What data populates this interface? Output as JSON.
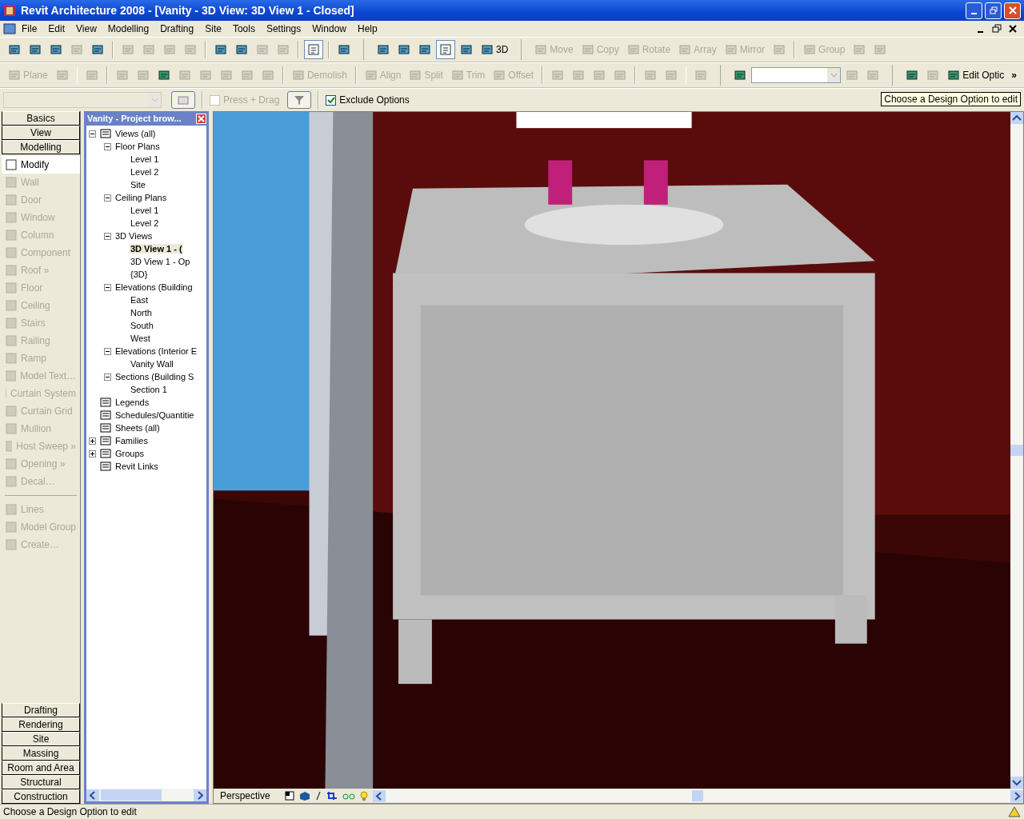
{
  "window": {
    "title": "Revit Architecture 2008 - [Vanity - 3D View: 3D View 1 - Closed]"
  },
  "menu": [
    "File",
    "Edit",
    "View",
    "Modelling",
    "Drafting",
    "Site",
    "Tools",
    "Settings",
    "Window",
    "Help"
  ],
  "toolbar_1": [
    {
      "kind": "tool",
      "disabled": false
    },
    {
      "kind": "tool",
      "disabled": false
    },
    {
      "kind": "tool",
      "disabled": false
    },
    {
      "kind": "tool",
      "disabled": true
    },
    {
      "kind": "tool",
      "disabled": false
    },
    {
      "kind": "separator"
    },
    {
      "kind": "tool",
      "disabled": true
    },
    {
      "kind": "tool",
      "disabled": true
    },
    {
      "kind": "tool",
      "disabled": true
    },
    {
      "kind": "tool",
      "disabled": true
    },
    {
      "kind": "separator"
    },
    {
      "kind": "tool",
      "disabled": false
    },
    {
      "kind": "tool",
      "disabled": false
    },
    {
      "kind": "tool",
      "disabled": true
    },
    {
      "kind": "tool",
      "disabled": true
    },
    {
      "kind": "separator"
    },
    {
      "kind": "toggle",
      "on": true
    },
    {
      "kind": "separator"
    },
    {
      "kind": "tool",
      "disabled": false
    },
    {
      "kind": "gap"
    },
    {
      "kind": "tool",
      "disabled": false
    },
    {
      "kind": "tool",
      "disabled": false
    },
    {
      "kind": "tool",
      "disabled": false
    },
    {
      "kind": "toggle",
      "on": true
    },
    {
      "kind": "tool",
      "disabled": false
    },
    {
      "kind": "tool",
      "label": "3D",
      "disabled": false
    },
    {
      "kind": "gap"
    },
    {
      "kind": "tool",
      "label": "Move",
      "disabled": true
    },
    {
      "kind": "tool",
      "label": "Copy",
      "disabled": true
    },
    {
      "kind": "tool",
      "label": "Rotate",
      "disabled": true
    },
    {
      "kind": "tool",
      "label": "Array",
      "disabled": true
    },
    {
      "kind": "tool",
      "label": "Mirror",
      "disabled": true
    },
    {
      "kind": "tool",
      "disabled": true
    },
    {
      "kind": "separator"
    },
    {
      "kind": "tool",
      "label": "Group",
      "disabled": true
    },
    {
      "kind": "tool",
      "disabled": true
    },
    {
      "kind": "tool",
      "disabled": true
    }
  ],
  "toolbar_2": [
    {
      "kind": "tool",
      "label": "Plane",
      "disabled": true
    },
    {
      "kind": "tool",
      "disabled": true
    },
    {
      "kind": "separator"
    },
    {
      "kind": "tool",
      "disabled": true
    },
    {
      "kind": "separator"
    },
    {
      "kind": "tool",
      "disabled": true
    },
    {
      "kind": "tool",
      "disabled": true
    },
    {
      "kind": "tool",
      "disabled": false
    },
    {
      "kind": "tool",
      "disabled": true
    },
    {
      "kind": "tool",
      "disabled": true
    },
    {
      "kind": "tool",
      "disabled": true
    },
    {
      "kind": "tool",
      "disabled": true
    },
    {
      "kind": "tool",
      "disabled": true
    },
    {
      "kind": "separator"
    },
    {
      "kind": "tool",
      "label": "Demolish",
      "disabled": true
    },
    {
      "kind": "separator"
    },
    {
      "kind": "tool",
      "label": "Align",
      "disabled": true
    },
    {
      "kind": "tool",
      "label": "Split",
      "disabled": true
    },
    {
      "kind": "tool",
      "label": "Trim",
      "disabled": true
    },
    {
      "kind": "tool",
      "label": "Offset",
      "disabled": true
    },
    {
      "kind": "separator"
    },
    {
      "kind": "tool",
      "disabled": true
    },
    {
      "kind": "tool",
      "disabled": true
    },
    {
      "kind": "tool",
      "disabled": true
    },
    {
      "kind": "tool",
      "disabled": true
    },
    {
      "kind": "separator"
    },
    {
      "kind": "tool",
      "disabled": true
    },
    {
      "kind": "tool",
      "disabled": true
    },
    {
      "kind": "separator"
    },
    {
      "kind": "tool",
      "disabled": true
    },
    {
      "kind": "gap"
    },
    {
      "kind": "tool",
      "disabled": false
    },
    {
      "kind": "dropdown"
    },
    {
      "kind": "tool",
      "disabled": true
    },
    {
      "kind": "tool",
      "disabled": true
    },
    {
      "kind": "gap"
    },
    {
      "kind": "tool",
      "disabled": false
    },
    {
      "kind": "tool",
      "disabled": true
    },
    {
      "kind": "tool",
      "label": "Edit Optic",
      "disabled": false
    },
    {
      "kind": "more",
      "label": "»"
    }
  ],
  "options_bar": {
    "press_drag": {
      "label": "Press + Drag",
      "checked": false,
      "disabled": true
    },
    "exclude_options": {
      "label": "Exclude Options",
      "checked": true,
      "disabled": false
    }
  },
  "tooltip": "Choose a Design Option to edit",
  "design_bar": {
    "tabs_top": [
      "Basics",
      "View",
      "Modelling"
    ],
    "tools": [
      {
        "label": "Modify",
        "disabled": false,
        "selected": true
      },
      {
        "label": "Wall",
        "disabled": true,
        "selected": false
      },
      {
        "label": "Door",
        "disabled": true,
        "selected": false
      },
      {
        "label": "Window",
        "disabled": true,
        "selected": false
      },
      {
        "label": "Column",
        "disabled": true,
        "selected": false
      },
      {
        "label": "Component",
        "disabled": true,
        "selected": false
      },
      {
        "label": "Roof »",
        "disabled": true,
        "selected": false
      },
      {
        "label": "Floor",
        "disabled": true,
        "selected": false
      },
      {
        "label": "Ceiling",
        "disabled": true,
        "selected": false
      },
      {
        "label": "Stairs",
        "disabled": true,
        "selected": false
      },
      {
        "label": "Railing",
        "disabled": true,
        "selected": false
      },
      {
        "label": "Ramp",
        "disabled": true,
        "selected": false
      },
      {
        "label": "Model Text…",
        "disabled": true,
        "selected": false
      },
      {
        "label": "Curtain System",
        "disabled": true,
        "selected": false
      },
      {
        "label": "Curtain Grid",
        "disabled": true,
        "selected": false
      },
      {
        "label": "Mullion",
        "disabled": true,
        "selected": false
      },
      {
        "label": "Host Sweep »",
        "disabled": true,
        "selected": false
      },
      {
        "label": "Opening »",
        "disabled": true,
        "selected": false
      },
      {
        "label": "Decal…",
        "disabled": true,
        "selected": false
      }
    ],
    "tools_2": [
      {
        "label": "Lines",
        "disabled": true,
        "selected": false
      },
      {
        "label": "Model Group",
        "disabled": true,
        "selected": false
      },
      {
        "label": "Create…",
        "disabled": true,
        "selected": false
      }
    ],
    "tabs_bottom": [
      "Drafting",
      "Rendering",
      "Site",
      "Massing",
      "Room and Area",
      "Structural",
      "Construction"
    ]
  },
  "project_browser": {
    "title": "Vanity - Project brow...",
    "tree": [
      {
        "label": "Views (all)",
        "expanded": true,
        "selected": false,
        "children": [
          {
            "label": "Floor Plans",
            "expanded": true,
            "selected": false,
            "children": [
              {
                "label": "Level 1",
                "selected": false
              },
              {
                "label": "Level 2",
                "selected": false
              },
              {
                "label": "Site",
                "selected": false
              }
            ]
          },
          {
            "label": "Ceiling Plans",
            "expanded": true,
            "selected": false,
            "children": [
              {
                "label": "Level 1",
                "selected": false
              },
              {
                "label": "Level 2",
                "selected": false
              }
            ]
          },
          {
            "label": "3D Views",
            "expanded": true,
            "selected": false,
            "children": [
              {
                "label": "3D View 1 - (",
                "selected": true
              },
              {
                "label": "3D View 1 - Op",
                "selected": false
              },
              {
                "label": "{3D}",
                "selected": false
              }
            ]
          },
          {
            "label": "Elevations (Building",
            "expanded": true,
            "selected": false,
            "children": [
              {
                "label": "East",
                "selected": false
              },
              {
                "label": "North",
                "selected": false
              },
              {
                "label": "South",
                "selected": false
              },
              {
                "label": "West",
                "selected": false
              }
            ]
          },
          {
            "label": "Elevations (Interior E",
            "expanded": true,
            "selected": false,
            "children": [
              {
                "label": "Vanity Wall",
                "selected": false
              }
            ]
          },
          {
            "label": "Sections (Building S",
            "expanded": true,
            "selected": false,
            "children": [
              {
                "label": "Section 1",
                "selected": false
              }
            ]
          }
        ]
      },
      {
        "label": "Legends",
        "selected": false
      },
      {
        "label": "Schedules/Quantitie",
        "selected": false
      },
      {
        "label": "Sheets (all)",
        "selected": false
      },
      {
        "label": "Families",
        "expanded": false,
        "selected": false
      },
      {
        "label": "Groups",
        "expanded": false,
        "selected": false
      },
      {
        "label": "Revit Links",
        "selected": false
      }
    ]
  },
  "view_control_bar": {
    "mode": "Perspective"
  },
  "status_bar": "Choose a Design Option to edit"
}
